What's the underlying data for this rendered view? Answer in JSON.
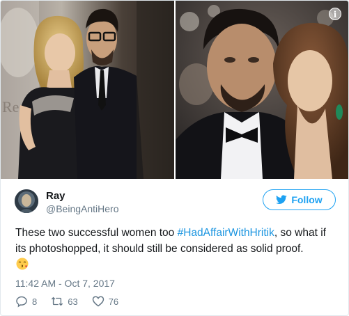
{
  "media": {
    "left_photo": {
      "backdrop_letters": "Re"
    },
    "info_icon": "info-icon",
    "info_symbol": "i"
  },
  "author": {
    "name": "Ray",
    "handle": "@BeingAntiHero",
    "avatar_icon": "avatar-hooded-figure"
  },
  "follow_button": {
    "label": "Follow",
    "icon": "twitter-bird-icon",
    "color": "#1da1f2"
  },
  "tweet": {
    "text_before": "These two successful women too ",
    "hashtag": "#HadAffairWithHritik",
    "text_after": ", so what if its photoshopped, it should still be considered as solid proof.",
    "emoji": "kissing-face-emoji",
    "timestamp": "11:42 AM - Oct 7, 2017"
  },
  "actions": {
    "reply_count": "8",
    "retweet_count": "63",
    "like_count": "76"
  },
  "colors": {
    "link": "#1b95e0",
    "secondary_text": "#657786",
    "border": "#e1e8ed"
  }
}
